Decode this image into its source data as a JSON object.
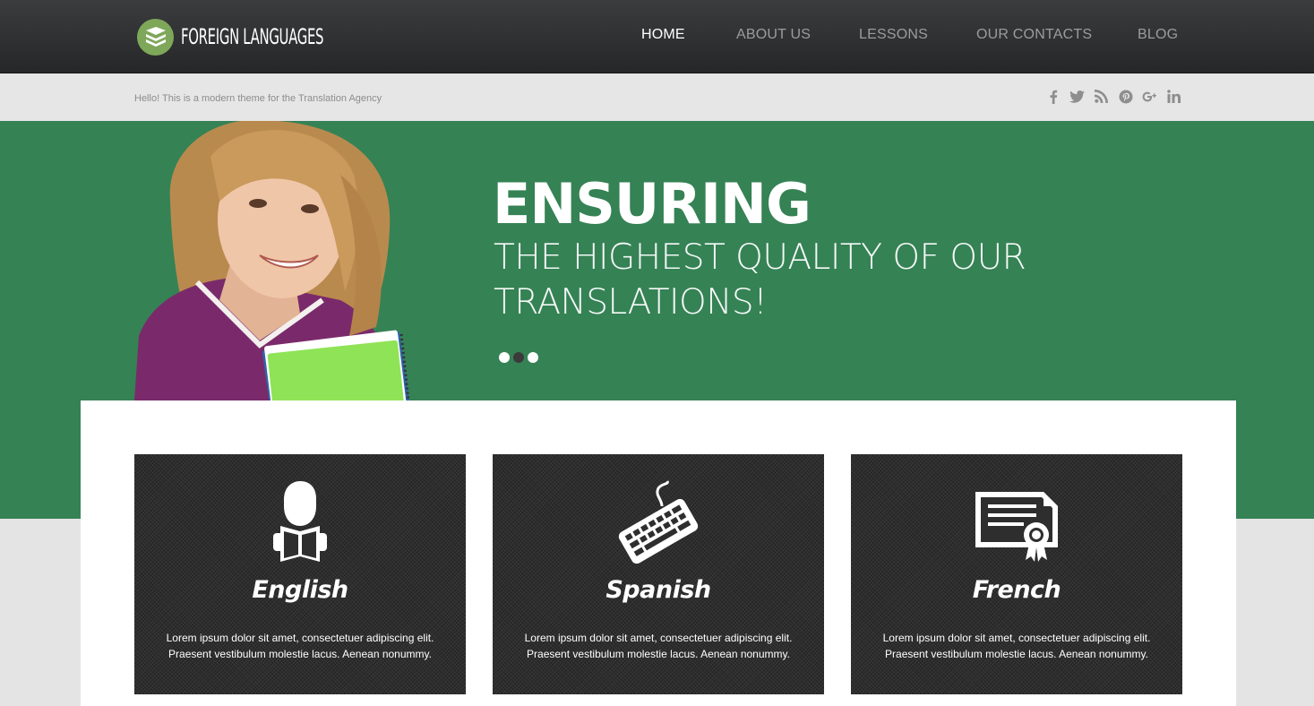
{
  "header": {
    "logo_text": "FOREIGN LANGUAGES",
    "nav": [
      {
        "label": "HOME",
        "active": true
      },
      {
        "label": "ABOUT US",
        "active": false
      },
      {
        "label": "LESSONS",
        "active": false
      },
      {
        "label": "OUR CONTACTS",
        "active": false
      },
      {
        "label": "BLOG",
        "active": false
      }
    ]
  },
  "topbar": {
    "tagline": "Hello! This is a modern theme for the Translation Agency",
    "social": [
      "facebook-icon",
      "twitter-icon",
      "rss-icon",
      "pinterest-icon",
      "google-plus-icon",
      "linkedin-icon"
    ]
  },
  "hero": {
    "title": "ENSURING",
    "subtitle": "THE HIGHEST QUALITY OF OUR TRANSLATIONS!",
    "slides": 3,
    "active_slide": 2
  },
  "cards": [
    {
      "title": "English",
      "icon": "reader-icon",
      "text": "Lorem ipsum dolor sit amet, consectetuer adipiscing elit. Praesent vestibulum molestie lacus. Aenean nonummy."
    },
    {
      "title": "Spanish",
      "icon": "keyboard-icon",
      "text": "Lorem ipsum dolor sit amet, consectetuer adipiscing elit. Praesent vestibulum molestie lacus. Aenean nonummy."
    },
    {
      "title": "French",
      "icon": "certificate-icon",
      "text": "Lorem ipsum dolor sit amet, consectetuer adipiscing elit. Praesent vestibulum molestie lacus. Aenean nonummy."
    }
  ],
  "colors": {
    "header_bg": "#2f3032",
    "hero_green": "#358255",
    "logo_green": "#7ea75a",
    "card_bg": "#2e2e2e",
    "nav_inactive": "#9c9c9c"
  }
}
